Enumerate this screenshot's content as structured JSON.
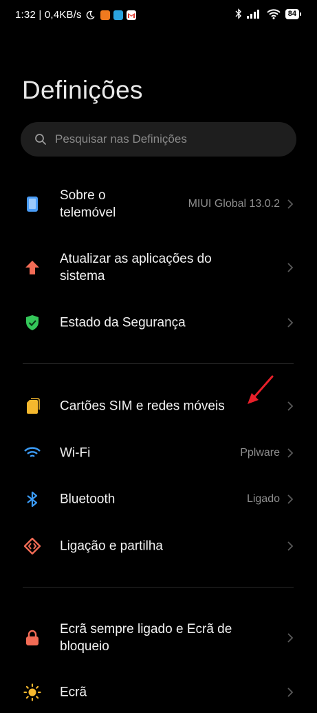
{
  "status_bar": {
    "time_speed": "1:32 | 0,4KB/s",
    "battery": "84",
    "icons": [
      "moon-icon",
      "app-icon-orange",
      "telegram-icon",
      "gmail-icon",
      "bluetooth-icon",
      "signal-icon",
      "wifi-icon",
      "battery-icon"
    ]
  },
  "page": {
    "title": "Definições"
  },
  "search": {
    "placeholder": "Pesquisar nas Definições"
  },
  "items": [
    {
      "label": "Sobre o telemóvel",
      "value": "MIUI Global 13.0.2",
      "icon": "phone-icon",
      "color": "#4a9df8"
    },
    {
      "label": "Atualizar as aplicações do sistema",
      "value": "",
      "icon": "arrow-up-icon",
      "color": "#f26b55"
    },
    {
      "label": "Estado da Segurança",
      "value": "",
      "icon": "shield-check-icon",
      "color": "#34c759"
    },
    {
      "label": "Cartões SIM e redes móveis",
      "value": "",
      "icon": "sim-card-icon",
      "color": "#f5b82e"
    },
    {
      "label": "Wi-Fi",
      "value": "Pplware",
      "icon": "wifi-icon",
      "color": "#3b9bf6"
    },
    {
      "label": "Bluetooth",
      "value": "Ligado",
      "icon": "bluetooth-icon",
      "color": "#3b9bf6"
    },
    {
      "label": "Ligação e partilha",
      "value": "",
      "icon": "connection-share-icon",
      "color": "#f26b55"
    },
    {
      "label": "Ecrã sempre ligado e Ecrã de bloqueio",
      "value": "",
      "icon": "lock-icon",
      "color": "#f26b55"
    },
    {
      "label": "Ecrã",
      "value": "",
      "icon": "sun-icon",
      "color": "#f5b82e"
    }
  ],
  "annotation": {
    "color": "#e8202a"
  }
}
